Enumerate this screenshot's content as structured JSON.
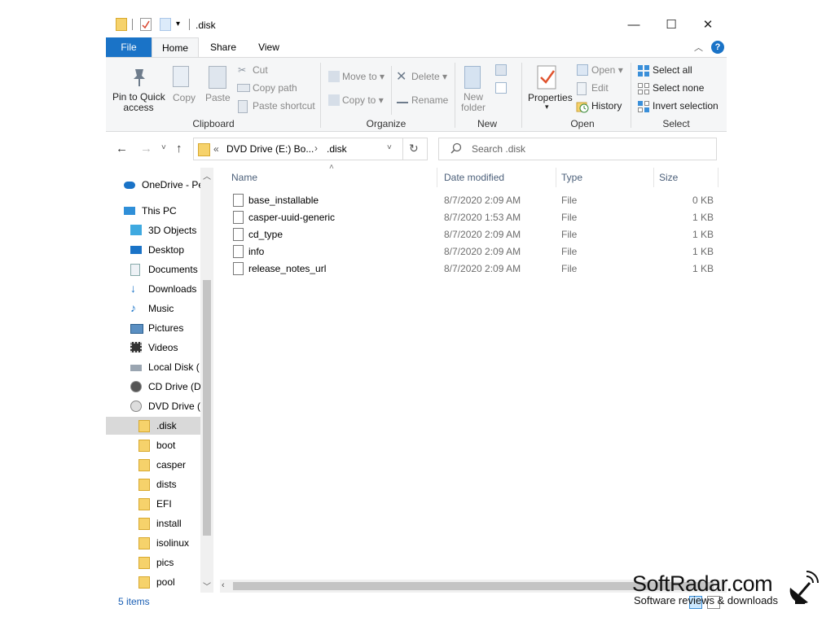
{
  "window": {
    "title": ".disk",
    "controls": {
      "minimize": "—",
      "maximize": "☐",
      "close": "✕"
    }
  },
  "tabs": {
    "file": "File",
    "home": "Home",
    "share": "Share",
    "view": "View"
  },
  "ribbon": {
    "clipboard": {
      "label": "Clipboard",
      "pin": [
        "Pin to Quick",
        "access"
      ],
      "copy": "Copy",
      "paste": "Paste",
      "cut": "Cut",
      "copy_path": "Copy path",
      "paste_shortcut": "Paste shortcut"
    },
    "organize": {
      "label": "Organize",
      "move_to": "Move to",
      "copy_to": "Copy to",
      "delete": "Delete",
      "rename": "Rename"
    },
    "new": {
      "label": "New",
      "new_folder": [
        "New",
        "folder"
      ]
    },
    "open": {
      "label": "Open",
      "properties": "Properties",
      "open": "Open",
      "edit": "Edit",
      "history": "History"
    },
    "select": {
      "label": "Select",
      "select_all": "Select all",
      "select_none": "Select none",
      "invert": "Invert selection"
    }
  },
  "navbar": {
    "breadcrumb_overflow": "«",
    "breadcrumb_1": "DVD Drive (E:) Bo...",
    "breadcrumb_sep": "›",
    "breadcrumb_2": ".disk",
    "search_placeholder": "Search .disk"
  },
  "nav_pane": [
    {
      "label": "OneDrive - Pe",
      "icon": "cloud-icon",
      "indent": 0
    },
    {
      "label": "This PC",
      "icon": "computer-icon",
      "indent": 0
    },
    {
      "label": "3D Objects",
      "icon": "cube-icon",
      "indent": 1
    },
    {
      "label": "Desktop",
      "icon": "desktop-icon",
      "indent": 1
    },
    {
      "label": "Documents",
      "icon": "document-icon",
      "indent": 1
    },
    {
      "label": "Downloads",
      "icon": "download-icon",
      "indent": 1
    },
    {
      "label": "Music",
      "icon": "music-icon",
      "indent": 1
    },
    {
      "label": "Pictures",
      "icon": "picture-icon",
      "indent": 1
    },
    {
      "label": "Videos",
      "icon": "video-icon",
      "indent": 1
    },
    {
      "label": "Local Disk (",
      "icon": "disk-icon",
      "indent": 1
    },
    {
      "label": "CD Drive (D",
      "icon": "cd-icon",
      "indent": 1
    },
    {
      "label": "DVD Drive (",
      "icon": "dvd-icon",
      "indent": 1
    },
    {
      "label": ".disk",
      "icon": "folder-icon",
      "indent": 2,
      "selected": true
    },
    {
      "label": "boot",
      "icon": "folder-icon",
      "indent": 2
    },
    {
      "label": "casper",
      "icon": "folder-icon",
      "indent": 2
    },
    {
      "label": "dists",
      "icon": "folder-icon",
      "indent": 2
    },
    {
      "label": "EFI",
      "icon": "folder-icon",
      "indent": 2
    },
    {
      "label": "install",
      "icon": "folder-icon",
      "indent": 2
    },
    {
      "label": "isolinux",
      "icon": "folder-icon",
      "indent": 2
    },
    {
      "label": "pics",
      "icon": "folder-icon",
      "indent": 2
    },
    {
      "label": "pool",
      "icon": "folder-icon",
      "indent": 2
    }
  ],
  "columns": {
    "name": "Name",
    "date": "Date modified",
    "type": "Type",
    "size": "Size"
  },
  "files": [
    {
      "name": "base_installable",
      "date": "8/7/2020 2:09 AM",
      "type": "File",
      "size": "0 KB"
    },
    {
      "name": "casper-uuid-generic",
      "date": "8/7/2020 1:53 AM",
      "type": "File",
      "size": "1 KB"
    },
    {
      "name": "cd_type",
      "date": "8/7/2020 2:09 AM",
      "type": "File",
      "size": "1 KB"
    },
    {
      "name": "info",
      "date": "8/7/2020 2:09 AM",
      "type": "File",
      "size": "1 KB"
    },
    {
      "name": "release_notes_url",
      "date": "8/7/2020 2:09 AM",
      "type": "File",
      "size": "1 KB"
    }
  ],
  "status": {
    "item_count": "5 items"
  },
  "watermark": {
    "title": "SoftRadar.com",
    "subtitle": "Software reviews & downloads"
  },
  "colors": {
    "accent": "#1a73c7",
    "folder": "#f6d26b",
    "selected_row": "#cce8ff"
  }
}
